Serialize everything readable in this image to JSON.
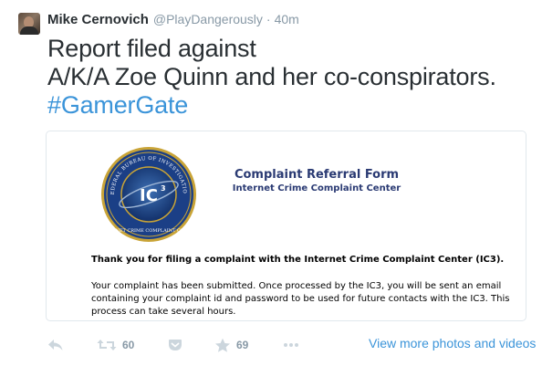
{
  "tweet": {
    "author_name": "Mike Cernovich",
    "author_handle": "@PlayDangerously",
    "separator": "·",
    "time": "40m",
    "text_line1": "Report filed against",
    "text_line2": "A/K/A Zoe Quinn and her co-conspirators.",
    "hashtag": "#GamerGate"
  },
  "card": {
    "form_title": "Complaint Referral Form",
    "form_subtitle": "Internet Crime Complaint Center",
    "seal_text": "FEDERAL BUREAU OF INVESTIGATION · INTERNET CRIME COMPLAINT CENTER",
    "seal_center": "IC3",
    "thanks": "Thank you for filing a complaint with the Internet Crime Complaint Center (IC3).",
    "body_line1": "Your complaint has been submitted. Once processed by the IC3, you will be sent an email",
    "body_line2": "containing your complaint id and password to be used for future contacts with the IC3. This",
    "body_line3": "process can take several hours."
  },
  "actions": {
    "retweet_count": "60",
    "favorite_count": "69",
    "view_more_label": "View more photos and videos"
  },
  "colors": {
    "link": "#3b94d9",
    "text": "#292f33",
    "muted": "#8899a6",
    "icon": "#ccd6dd",
    "form_title": "#2a3a73"
  }
}
